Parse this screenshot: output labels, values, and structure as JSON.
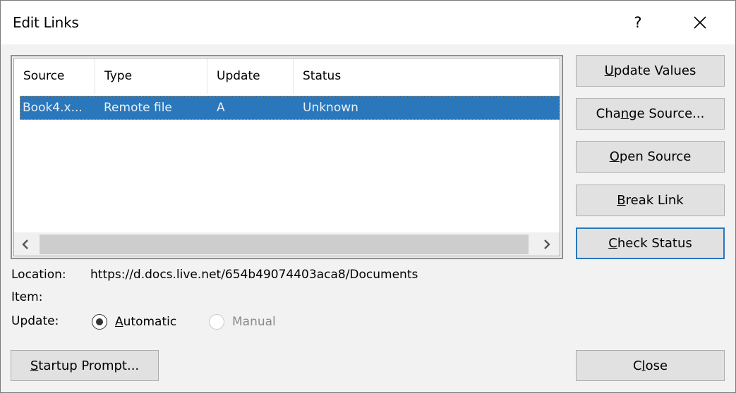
{
  "window": {
    "title": "Edit Links",
    "help_label": "?",
    "close_icon": "close-x-icon"
  },
  "list": {
    "columns": [
      "Source",
      "Type",
      "Update",
      "Status"
    ],
    "rows": [
      {
        "source": "Book4.x...",
        "type": "Remote file",
        "update": "A",
        "status": "Unknown",
        "selected": true
      }
    ],
    "scroll_left": "‹",
    "scroll_right": "›"
  },
  "buttons": {
    "update_values": {
      "pre": "",
      "accel": "U",
      "post": "pdate Values"
    },
    "change_source": {
      "pre": "Cha",
      "accel": "n",
      "post": "ge Source..."
    },
    "open_source": {
      "pre": "",
      "accel": "O",
      "post": "pen Source"
    },
    "break_link": {
      "pre": "",
      "accel": "B",
      "post": "reak Link"
    },
    "check_status": {
      "pre": "",
      "accel": "C",
      "post": "heck Status"
    },
    "startup_prompt": {
      "pre": "",
      "accel": "S",
      "post": "tartup Prompt..."
    },
    "close": {
      "pre": "C",
      "accel": "l",
      "post": "ose"
    }
  },
  "details": {
    "location_label": "Location:",
    "location_value": "https://d.docs.live.net/654b49074403aca8/Documents",
    "item_label": "Item:",
    "item_value": "",
    "update_label": "Update:",
    "automatic": {
      "pre": "",
      "accel": "A",
      "post": "utomatic",
      "checked": true
    },
    "manual": {
      "label": "Manual",
      "checked": false,
      "disabled": true
    }
  },
  "colors": {
    "selection": "#2a77bc",
    "default_button_border": "#2a77bc",
    "button_face": "#e1e1e1",
    "dialog_bg": "#f2f2f2"
  }
}
